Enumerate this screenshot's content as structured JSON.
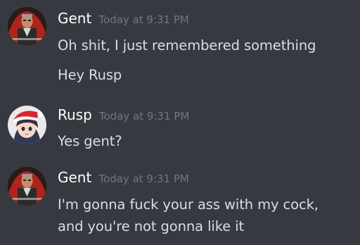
{
  "messages": [
    {
      "author": "Gent",
      "timestamp": "Today at 9:31 PM",
      "lines": [
        "Oh shit, I just remembered something",
        "Hey Rusp"
      ]
    },
    {
      "author": "Rusp",
      "timestamp": "Today at 9:31 PM",
      "lines": [
        "Yes gent?"
      ]
    },
    {
      "author": "Gent",
      "timestamp": "Today at 9:31 PM",
      "lines": [
        "I'm gonna fuck your ass with my cock,",
        "and you're not gonna like it"
      ]
    }
  ],
  "colors": {
    "background": "#36393f",
    "username": "#ffffff",
    "timestamp": "#72767d",
    "message_text": "#dcddde"
  },
  "icons": {
    "gent_avatar": "avatar-gent-icon",
    "rusp_avatar": "avatar-rusp-icon"
  }
}
